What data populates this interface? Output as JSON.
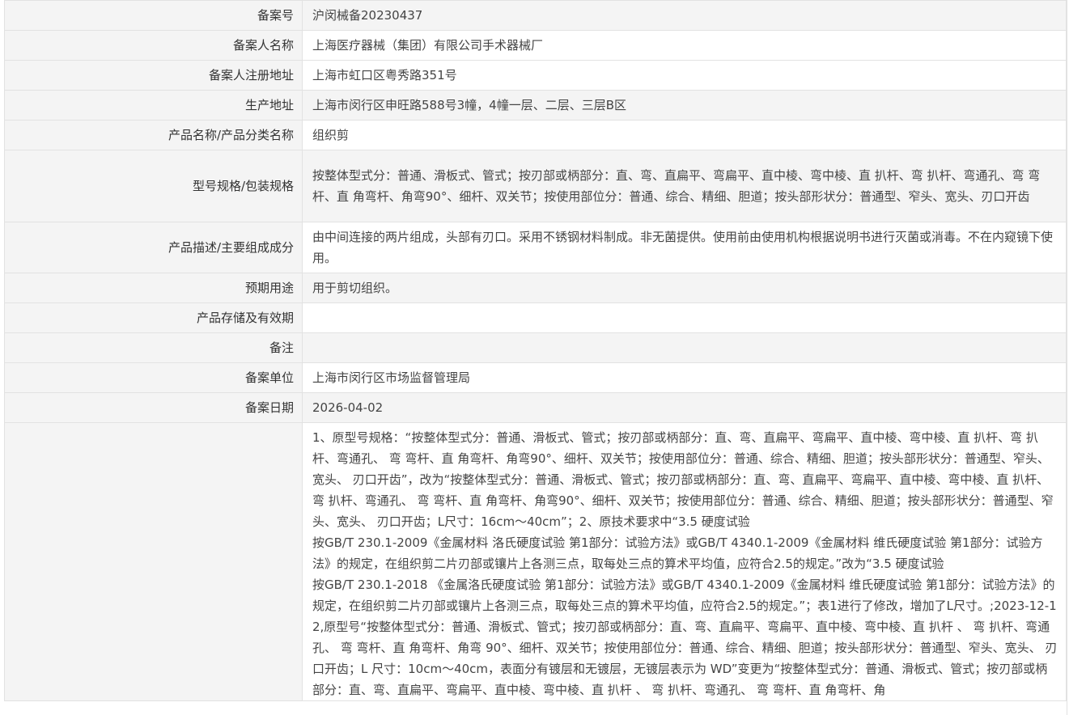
{
  "rows": [
    {
      "label": "备案号",
      "value": "沪闵械备20230437"
    },
    {
      "label": "备案人名称",
      "value": "上海医疗器械（集团）有限公司手术器械厂"
    },
    {
      "label": "备案人注册地址",
      "value": "上海市虹口区粤秀路351号"
    },
    {
      "label": "生产地址",
      "value": "上海市闵行区申旺路588号3幢，4幢一层、二层、三层B区"
    },
    {
      "label": "产品名称/产品分类名称",
      "value": "组织剪"
    },
    {
      "label": "型号规格/包装规格",
      "value": "按整体型式分：普通、滑板式、管式；按刃部或柄部分：直、弯、直扁平、弯扁平、直中棱、弯中棱、直 扒杆、弯 扒杆、弯通孔、弯 弯杆、直 角弯杆、角弯90°、细杆、双关节；按使用部位分：普通、综合、精细、胆道；按头部形状分：普通型、窄头、宽头、刃口开齿"
    },
    {
      "label": "产品描述/主要组成成分",
      "value": "由中间连接的两片组成，头部有刃口。采用不锈钢材料制成。非无菌提供。使用前由使用机构根据说明书进行灭菌或消毒。不在内窥镜下使用。"
    },
    {
      "label": "预期用途",
      "value": "用于剪切组织。"
    },
    {
      "label": "产品存储及有效期",
      "value": ""
    },
    {
      "label": "备注",
      "value": ""
    },
    {
      "label": "备案单位",
      "value": "上海市闵行区市场监督管理局"
    },
    {
      "label": "备案日期",
      "value": "2026-04-02"
    }
  ],
  "change_record": {
    "label": "",
    "value": "1、原型号规格：“按整体型式分：普通、滑板式、管式；按刃部或柄部分：直、弯、直扁平、弯扁平、直中棱、弯中棱、直 扒杆、弯 扒杆、弯通孔、 弯 弯杆、直 角弯杆、角弯90°、细杆、双关节；按使用部位分：普通、综合、精细、胆道；按头部形状分：普通型、窄头、宽头、 刃口开齿”，改为“按整体型式分：普通、滑板式、管式；按刃部或柄部分：直、弯、直扁平、弯扁平、直中棱、弯中棱、直 扒杆、弯 扒杆、弯通孔、 弯 弯杆、直 角弯杆、角弯90°、细杆、双关节；按使用部位分：普通、综合、精细、胆道；按头部形状分：普通型、窄头、宽头、 刃口开齿；L尺寸：16cm～40cm”；2、原技术要求中“3.5 硬度试验\n按GB/T 230.1-2009《金属材料 洛氏硬度试验 第1部分：试验方法》或GB/T 4340.1-2009《金属材料 维氏硬度试验 第1部分：试验方法》的规定，在组织剪二片刃部或镶片上各测三点，取每处三点的算术平均值，应符合2.5的规定。”改为“3.5 硬度试验\n按GB/T 230.1-2018 《金属洛氏硬度试验 第1部分：试验方法》或GB/T 4340.1-2009《金属材料 维氏硬度试验 第1部分：试验方法》的规定，在组织剪二片刃部或镶片上各测三点，取每处三点的算术平均值，应符合2.5的规定。”；表1进行了修改，增加了L尺寸。;2023-12-12,原型号“按整体型式分：普通、滑板式、管式；按刃部或柄部分：直、弯、直扁平、弯扁平、直中棱、弯中棱、直 扒杆 、 弯 扒杆、弯通孔、 弯 弯杆、直 角弯杆、角弯 90°、细杆、双关节；按使用部位分：普通、综合、精细、胆道；按头部形状分：普通型、窄头、宽头、 刃口开齿；L 尺寸：10cm～40cm，表面分有镀层和无镀层，无镀层表示为 WD”变更为“按整体型式分：普通、滑板式、管式；按刃部或柄部分：直、弯、直扁平、弯扁平、直中棱、弯中棱、直 扒杆 、 弯 扒杆、弯通孔、 弯 弯杆、直 角弯杆、角"
  }
}
